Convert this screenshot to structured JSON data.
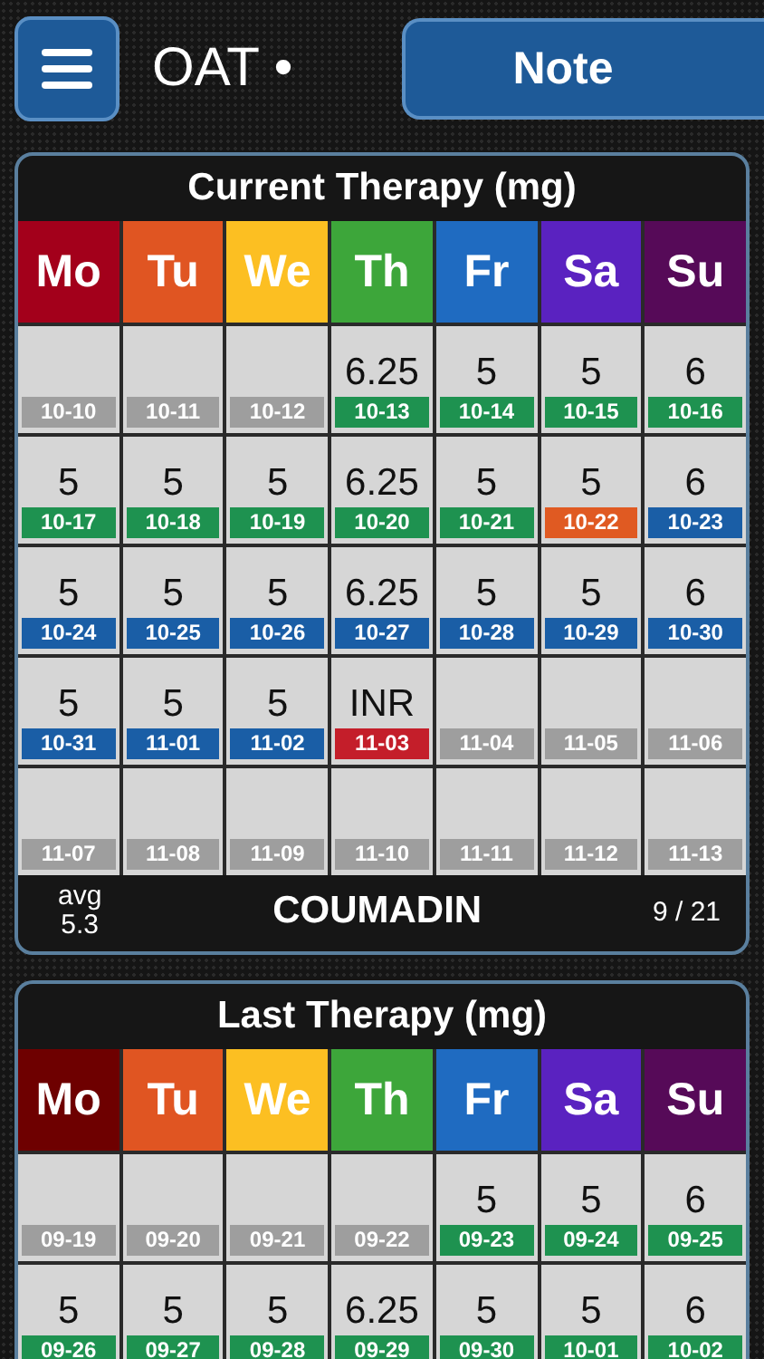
{
  "header": {
    "title": "OAT •",
    "note_button": "Note"
  },
  "current": {
    "title": "Current Therapy (mg)",
    "days": [
      {
        "label": "Mo",
        "color": "#a3001b"
      },
      {
        "label": "Tu",
        "color": "#e05522"
      },
      {
        "label": "We",
        "color": "#fcbf22"
      },
      {
        "label": "Th",
        "color": "#3da63a"
      },
      {
        "label": "Fr",
        "color": "#1f6bc1"
      },
      {
        "label": "Sa",
        "color": "#5a22c0"
      },
      {
        "label": "Su",
        "color": "#560a58"
      }
    ],
    "cells": [
      {
        "date": "10-10",
        "color": "#9e9e9e"
      },
      {
        "date": "10-11",
        "color": "#9e9e9e"
      },
      {
        "date": "10-12",
        "color": "#9e9e9e"
      },
      {
        "value": "6.25",
        "date": "10-13",
        "color": "#1e9250"
      },
      {
        "value": "5",
        "date": "10-14",
        "color": "#1e9250"
      },
      {
        "value": "5",
        "date": "10-15",
        "color": "#1e9250"
      },
      {
        "value": "6",
        "date": "10-16",
        "color": "#1e9250"
      },
      {
        "value": "5",
        "date": "10-17",
        "color": "#1e9250"
      },
      {
        "value": "5",
        "date": "10-18",
        "color": "#1e9250"
      },
      {
        "value": "5",
        "date": "10-19",
        "color": "#1e9250"
      },
      {
        "value": "6.25",
        "date": "10-20",
        "color": "#1e9250"
      },
      {
        "value": "5",
        "date": "10-21",
        "color": "#1e9250"
      },
      {
        "value": "5",
        "date": "10-22",
        "color": "#e05a22"
      },
      {
        "value": "6",
        "date": "10-23",
        "color": "#1a5ea6"
      },
      {
        "value": "5",
        "date": "10-24",
        "color": "#1a5ea6"
      },
      {
        "value": "5",
        "date": "10-25",
        "color": "#1a5ea6"
      },
      {
        "value": "5",
        "date": "10-26",
        "color": "#1a5ea6"
      },
      {
        "value": "6.25",
        "date": "10-27",
        "color": "#1a5ea6"
      },
      {
        "value": "5",
        "date": "10-28",
        "color": "#1a5ea6"
      },
      {
        "value": "5",
        "date": "10-29",
        "color": "#1a5ea6"
      },
      {
        "value": "6",
        "date": "10-30",
        "color": "#1a5ea6"
      },
      {
        "value": "5",
        "date": "10-31",
        "color": "#1a5ea6"
      },
      {
        "value": "5",
        "date": "11-01",
        "color": "#1a5ea6"
      },
      {
        "value": "5",
        "date": "11-02",
        "color": "#1a5ea6"
      },
      {
        "value": "INR",
        "date": "11-03",
        "color": "#c41e2a"
      },
      {
        "date": "11-04",
        "color": "#9e9e9e"
      },
      {
        "date": "11-05",
        "color": "#9e9e9e"
      },
      {
        "date": "11-06",
        "color": "#9e9e9e"
      },
      {
        "date": "11-07",
        "color": "#9e9e9e"
      },
      {
        "date": "11-08",
        "color": "#9e9e9e"
      },
      {
        "date": "11-09",
        "color": "#9e9e9e"
      },
      {
        "date": "11-10",
        "color": "#9e9e9e"
      },
      {
        "date": "11-11",
        "color": "#9e9e9e"
      },
      {
        "date": "11-12",
        "color": "#9e9e9e"
      },
      {
        "date": "11-13",
        "color": "#9e9e9e"
      }
    ],
    "footer": {
      "avg_label": "avg",
      "avg_value": "5.3",
      "drug": "COUMADIN",
      "count": "9 / 21"
    }
  },
  "last": {
    "title": "Last Therapy (mg)",
    "days": [
      {
        "label": "Mo",
        "color": "#6e0000"
      },
      {
        "label": "Tu",
        "color": "#e05522"
      },
      {
        "label": "We",
        "color": "#fcbf22"
      },
      {
        "label": "Th",
        "color": "#3da63a"
      },
      {
        "label": "Fr",
        "color": "#1f6bc1"
      },
      {
        "label": "Sa",
        "color": "#5a22c0"
      },
      {
        "label": "Su",
        "color": "#560a58"
      }
    ],
    "cells": [
      {
        "date": "09-19",
        "color": "#9e9e9e"
      },
      {
        "date": "09-20",
        "color": "#9e9e9e"
      },
      {
        "date": "09-21",
        "color": "#9e9e9e"
      },
      {
        "date": "09-22",
        "color": "#9e9e9e"
      },
      {
        "value": "5",
        "date": "09-23",
        "color": "#1e9250"
      },
      {
        "value": "5",
        "date": "09-24",
        "color": "#1e9250"
      },
      {
        "value": "6",
        "date": "09-25",
        "color": "#1e9250"
      },
      {
        "value": "5",
        "date": "09-26",
        "color": "#1e9250"
      },
      {
        "value": "5",
        "date": "09-27",
        "color": "#1e9250"
      },
      {
        "value": "5",
        "date": "09-28",
        "color": "#1e9250"
      },
      {
        "value": "6.25",
        "date": "09-29",
        "color": "#1e9250"
      },
      {
        "value": "5",
        "date": "09-30",
        "color": "#1e9250"
      },
      {
        "value": "5",
        "date": "10-01",
        "color": "#1e9250"
      },
      {
        "value": "6",
        "date": "10-02",
        "color": "#1e9250"
      }
    ]
  }
}
